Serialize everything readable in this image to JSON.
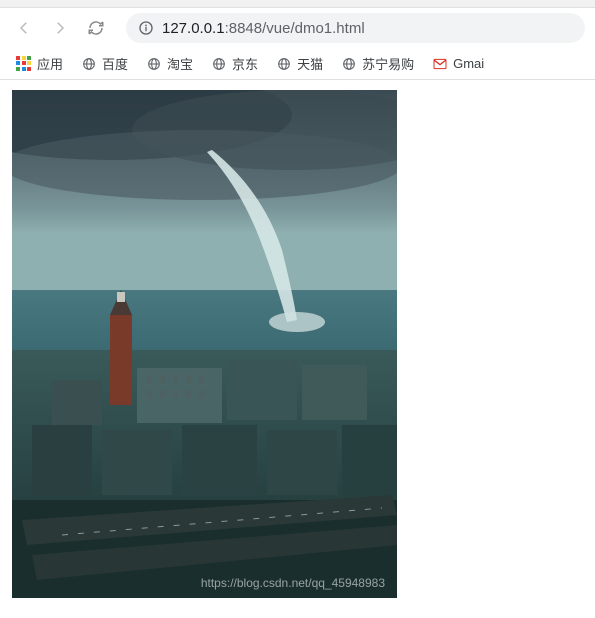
{
  "url": {
    "host": "127.0.0.1",
    "port_path": ":8848/vue/dmo1.html"
  },
  "bookmarks": {
    "apps_label": "应用",
    "items": [
      {
        "label": "百度"
      },
      {
        "label": "淘宝"
      },
      {
        "label": "京东"
      },
      {
        "label": "天猫"
      },
      {
        "label": "苏宁易购"
      }
    ],
    "gmail_label": "Gmai"
  },
  "watermark": "https://blog.csdn.net/qq_45948983"
}
